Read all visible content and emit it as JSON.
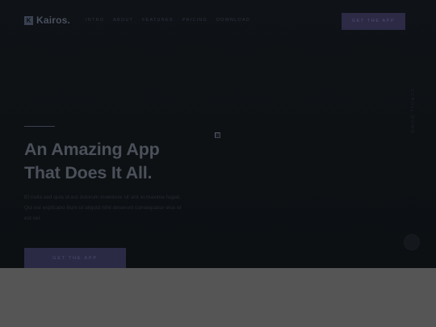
{
  "header": {
    "logo_mark": "K",
    "logo_text": "Kairos.",
    "nav": [
      "Intro",
      "About",
      "Features",
      "Pricing",
      "Download"
    ],
    "cta_label": "Get The App"
  },
  "hero": {
    "headline_line1": "An Amazing App",
    "headline_line2": "That Does It All.",
    "body": "Et nulla sed quia ut est dolorum inventore sit sint et maxime fugiat. Qui est explicabo illum ut aliquid nihil deserunt consequatur eius et est vel.",
    "cta_label": "Get The App",
    "image_alt": ""
  },
  "sidebar": {
    "vertical_text": "Scroll Down"
  },
  "colors": {
    "background": "#0e1114",
    "accent": "#2c2a45",
    "bottom_band": "#555555"
  }
}
